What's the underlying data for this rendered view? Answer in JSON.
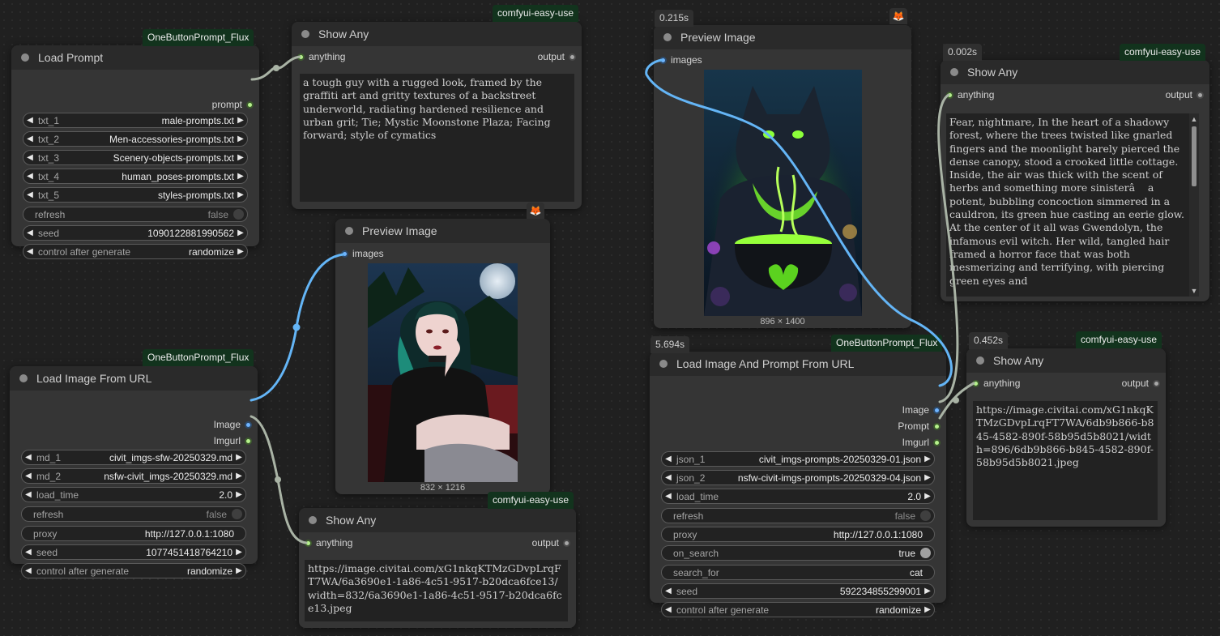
{
  "nodes": {
    "load_prompt": {
      "tag": "OneButtonPrompt_Flux",
      "title": "Load Prompt",
      "output": "prompt",
      "widgets": [
        {
          "label": "txt_1",
          "value": "male-prompts.txt"
        },
        {
          "label": "txt_2",
          "value": "Men-accessories-prompts.txt"
        },
        {
          "label": "txt_3",
          "value": "Scenery-objects-prompts.txt"
        },
        {
          "label": "txt_4",
          "value": "human_poses-prompts.txt"
        },
        {
          "label": "txt_5",
          "value": "styles-prompts.txt"
        },
        {
          "label": "refresh",
          "value": "false"
        },
        {
          "label": "seed",
          "value": "1090122881990562"
        },
        {
          "label": "control after generate",
          "value": "randomize"
        }
      ]
    },
    "show_any_1": {
      "tag": "comfyui-easy-use",
      "title": "Show Any",
      "input": "anything",
      "output": "output",
      "text": "a tough guy with a rugged look, framed by the graffiti art and gritty textures of a backstreet underworld, radiating hardened resilience and urban grit; Tie; Mystic Moonstone Plaza; Facing forward; style of cymatics"
    },
    "preview_image_1": {
      "title": "Preview Image",
      "input": "images",
      "caption": "832 × 1216"
    },
    "load_image_url": {
      "tag": "OneButtonPrompt_Flux",
      "title": "Load Image From URL",
      "outputs": [
        "Image",
        "Imgurl"
      ],
      "widgets": [
        {
          "label": "md_1",
          "value": "civit_imgs-sfw-20250329.md"
        },
        {
          "label": "md_2",
          "value": "nsfw-civit_imgs-20250329.md"
        },
        {
          "label": "load_time",
          "value": "2.0"
        },
        {
          "label": "refresh",
          "value": "false"
        },
        {
          "label": "proxy",
          "value": "http://127.0.0.1:1080"
        },
        {
          "label": "seed",
          "value": "1077451418764210"
        },
        {
          "label": "control after generate",
          "value": "randomize"
        }
      ]
    },
    "show_any_2": {
      "tag": "comfyui-easy-use",
      "title": "Show Any",
      "input": "anything",
      "output": "output",
      "text": "https://image.civitai.com/xG1nkqKTMzGDvpLrqFT7WA/6a3690e1-1a86-4c51-9517-b20dca6fce13/width=832/6a3690e1-1a86-4c51-9517-b20dca6fce13.jpeg"
    },
    "preview_image_2": {
      "timer": "0.215s",
      "title": "Preview Image",
      "input": "images",
      "caption": "896 × 1400"
    },
    "load_image_prompt_url": {
      "timer": "5.694s",
      "tag": "OneButtonPrompt_Flux",
      "title": "Load Image And Prompt From URL",
      "outputs": [
        "Image",
        "Prompt",
        "Imgurl"
      ],
      "widgets": [
        {
          "label": "json_1",
          "value": "civit_imgs-prompts-20250329-01.json"
        },
        {
          "label": "json_2",
          "value": "nsfw-civit-imgs-prompts-20250329-04.json"
        },
        {
          "label": "load_time",
          "value": "2.0"
        },
        {
          "label": "refresh",
          "value": "false"
        },
        {
          "label": "proxy",
          "value": "http://127.0.0.1:1080"
        },
        {
          "label": "on_search",
          "value": "true"
        },
        {
          "label": "search_for",
          "value": "cat"
        },
        {
          "label": "seed",
          "value": "592234855299001"
        },
        {
          "label": "control after generate",
          "value": "randomize"
        }
      ]
    },
    "show_any_3": {
      "timer": "0.002s",
      "tag": "comfyui-easy-use",
      "title": "Show Any",
      "input": "anything",
      "output": "output",
      "text": "Fear, nightmare, In the heart of a shadowy forest, where the trees twisted like gnarled fingers and the moonlight barely pierced the dense canopy, stood a crooked little cottage. Inside, the air was thick with the scent of herbs and something more sinisterâ    a potent, bubbling concoction simmered in a cauldron, its green hue casting an eerie glow. At the center of it all was Gwendolyn, the infamous evil witch. Her wild, tangled hair framed a horror face that was both mesmerizing and terrifying, with piercing green eyes and"
    },
    "show_any_4": {
      "timer": "0.452s",
      "tag": "comfyui-easy-use",
      "title": "Show Any",
      "input": "anything",
      "output": "output",
      "text": "https://image.civitai.com/xG1nkqKTMzGDvpLrqFT7WA/6db9b866-b845-4582-890f-58b95d5b8021/width=896/6db9b866-b845-4582-890f-58b95d5b8021.jpeg"
    }
  },
  "colors": {
    "canvas": "#202020",
    "node_body": "#353535",
    "node_title": "#2a2a2a",
    "tag_green": "#12331d",
    "wire_image": "#64b5f6",
    "wire_any": "#a9b3a5"
  },
  "icons": [
    "fox-icon"
  ]
}
